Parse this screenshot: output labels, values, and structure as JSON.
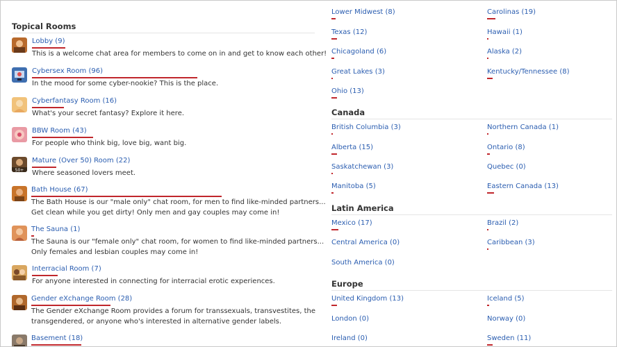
{
  "topical": {
    "title": "Topical Rooms",
    "rooms": [
      {
        "label": "Lobby (9)",
        "desc": [
          "This is a welcome chat area for members to come on in and get to know each other!"
        ],
        "avatar": "lobby"
      },
      {
        "label": "Cybersex Room (96)",
        "desc": [
          "In the mood for some cyber-nookie? This is the place."
        ],
        "avatar": "cyber"
      },
      {
        "label": "Cyberfantasy Room (16)",
        "desc": [
          "What's your secret fantasy? Explore it here."
        ],
        "avatar": "fantasy"
      },
      {
        "label": "BBW Room (43)",
        "desc": [
          "For people who think big, love big, want big."
        ],
        "avatar": "bbw"
      },
      {
        "label": "Mature (Over 50) Room (22)",
        "desc": [
          "Where seasoned lovers meet."
        ],
        "avatar": "mature"
      },
      {
        "label": "Bath House (67)",
        "desc": [
          "The Bath House is our \"male only\" chat room, for men to find like-minded partners...",
          "Get clean while you get dirty! Only men and gay couples may come in!"
        ],
        "avatar": "bath"
      },
      {
        "label": "The Sauna (1)",
        "desc": [
          "The Sauna is our \"female only\" chat room, for women to find like-minded partners...",
          "Only females and lesbian couples may come in!"
        ],
        "avatar": "sauna"
      },
      {
        "label": "Interracial Room (7)",
        "desc": [
          "For anyone interested in connecting for interracial erotic experiences."
        ],
        "avatar": "interracial"
      },
      {
        "label": "Gender eXchange Room (28)",
        "desc": [
          "The Gender eXchange Room provides a forum for transsexuals, transvestites, the",
          "transgendered, or anyone who's interested in alternative gender labels."
        ],
        "avatar": "gender"
      },
      {
        "label": "Basement (18)",
        "desc": [],
        "avatar": "basement"
      }
    ]
  },
  "usa_cont": {
    "left": [
      "Lower Midwest (8)",
      "Texas (12)",
      "Chicagoland (6)",
      "Great Lakes (3)",
      "Ohio (13)"
    ],
    "right": [
      "Carolinas (19)",
      "Hawaii (1)",
      "Alaska (2)",
      "Kentucky/Tennessee (8)"
    ]
  },
  "canada": {
    "title": "Canada",
    "left": [
      "British Columbia (3)",
      "Alberta (15)",
      "Saskatchewan (3)",
      "Manitoba (5)"
    ],
    "right": [
      "Northern Canada (1)",
      "Ontario (8)",
      "Quebec (0)",
      "Eastern Canada (13)"
    ]
  },
  "latin": {
    "title": "Latin America",
    "left": [
      "Mexico (17)",
      "Central America (0)",
      "South America (0)"
    ],
    "right": [
      "Brazil (2)",
      "Caribbean (3)"
    ]
  },
  "europe": {
    "title": "Europe",
    "left": [
      "United Kingdom (13)",
      "London (0)",
      "Ireland (0)"
    ],
    "right": [
      "Iceland (5)",
      "Norway (0)",
      "Sweden (11)"
    ]
  },
  "colors": {
    "link": "#2a5db0",
    "activity_bar": "#c0262b"
  }
}
